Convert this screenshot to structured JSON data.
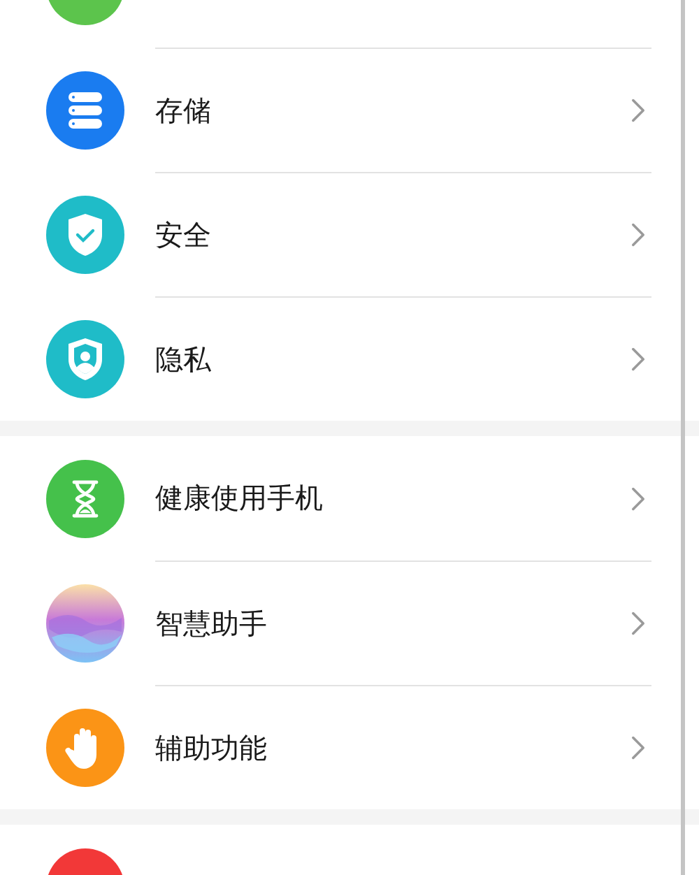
{
  "sections": [
    {
      "items": [
        {
          "kind": "green"
        },
        {
          "kind": "storage",
          "label": "存储"
        },
        {
          "kind": "security",
          "label": "安全"
        },
        {
          "kind": "privacy",
          "label": "隐私"
        }
      ]
    },
    {
      "items": [
        {
          "kind": "hourglass",
          "label": "健康使用手机"
        },
        {
          "kind": "assistant",
          "label": "智慧助手"
        },
        {
          "kind": "hand",
          "label": "辅助功能"
        }
      ]
    },
    {
      "items": [
        {
          "kind": "red"
        }
      ]
    }
  ]
}
